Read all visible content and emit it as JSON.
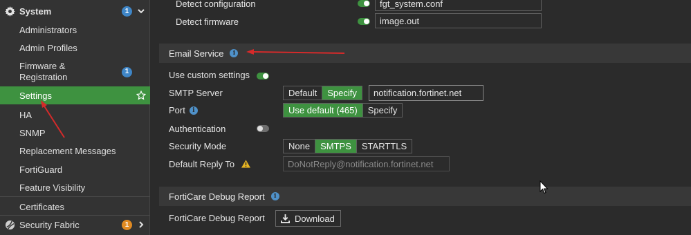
{
  "sidebar": {
    "system": {
      "label": "System",
      "badge": "1"
    },
    "items": [
      {
        "label": "Administrators"
      },
      {
        "label": "Admin Profiles"
      },
      {
        "label": "Firmware &\nRegistration",
        "badge": "1"
      },
      {
        "label": "Settings"
      },
      {
        "label": "HA"
      },
      {
        "label": "SNMP"
      },
      {
        "label": "Replacement Messages"
      },
      {
        "label": "FortiGuard"
      },
      {
        "label": "Feature Visibility"
      },
      {
        "label": "Certificates"
      }
    ],
    "security_fabric": {
      "label": "Security Fabric",
      "badge": "1"
    }
  },
  "main": {
    "detect_configuration": {
      "label": "Detect configuration",
      "value": "fgt_system.conf"
    },
    "detect_firmware": {
      "label": "Detect firmware",
      "value": "image.out"
    },
    "email_service": {
      "title": "Email Service",
      "use_custom_settings": {
        "label": "Use custom settings"
      },
      "smtp_server": {
        "label": "SMTP Server",
        "options": [
          "Default",
          "Specify"
        ],
        "selected": "Specify",
        "value": "notification.fortinet.net"
      },
      "port": {
        "label": "Port",
        "options": [
          "Use default (465)",
          "Specify"
        ],
        "selected": "Use default (465)"
      },
      "authentication": {
        "label": "Authentication"
      },
      "security_mode": {
        "label": "Security Mode",
        "options": [
          "None",
          "SMTPS",
          "STARTTLS"
        ],
        "selected": "SMTPS"
      },
      "default_reply_to": {
        "label": "Default Reply To",
        "placeholder": "DoNotReply@notification.fortinet.net"
      }
    },
    "forticare_debug": {
      "title": "FortiCare Debug Report",
      "row_label": "FortiCare Debug Report",
      "download_label": "Download"
    }
  },
  "colors": {
    "accent_green": "#3e9240",
    "info_blue": "#4f91c9",
    "badge_blue": "#3f86c7",
    "badge_orange": "#e08a22",
    "warning": "#e6b422",
    "annotation_red": "#d62a2a"
  },
  "icons": [
    "gear-icon",
    "chevron-down-icon",
    "star-icon",
    "info-icon",
    "warning-icon",
    "download-icon",
    "security-fabric-icon",
    "chevron-right-icon",
    "mouse-cursor-icon"
  ]
}
